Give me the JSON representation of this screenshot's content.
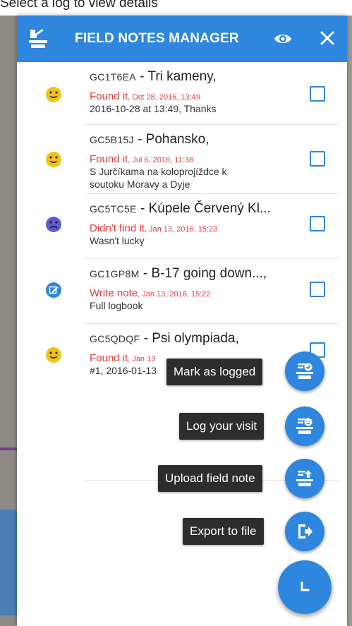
{
  "background": {
    "caption": "Select a log to view details"
  },
  "header": {
    "title": "FIELD NOTES MANAGER"
  },
  "notes": [
    {
      "code": "GC1T6EA",
      "name": " - Tri kameny,",
      "status": "found",
      "log_type": "Found it",
      "date": ", Oct 28, 2016, 13:49",
      "comment": "2016-10-28 at 13:49, Thanks"
    },
    {
      "code": "GC5B15J",
      "name": " - Pohansko,",
      "status": "found",
      "log_type": "Found it",
      "date": ", Jul 6, 2016, 11:38",
      "comment": "S Jurčíkama na koloprojíždce k soutoku Moravy a Dyje"
    },
    {
      "code": "GC5TC5E",
      "name": " - Kúpele Červený Kl...",
      "status": "dnf",
      "log_type": "Didn't find it",
      "date": ", Jan 13, 2016, 15:23",
      "comment": "Wasn't lucky"
    },
    {
      "code": "GC1GP8M",
      "name": " - B-17 going down...,",
      "status": "note",
      "log_type": "Write note",
      "date": ", Jan 13, 2016, 15:22",
      "comment": "Full logbook"
    },
    {
      "code": "GC5QDQF",
      "name": " - Psi olympiada,",
      "status": "found",
      "log_type": "Found it",
      "date": ", Jan 13",
      "comment": "#1, 2016-01-13"
    }
  ],
  "fab_menu": {
    "mark_logged": "Mark as logged",
    "log_visit": "Log your visit",
    "upload_note": "Upload field note",
    "export_file": "Export to file"
  },
  "colors": {
    "primary": "#2e86de",
    "log_type": "#e03b3b",
    "found_face": "#f2c316",
    "dnf_face": "#5b5bd6"
  }
}
